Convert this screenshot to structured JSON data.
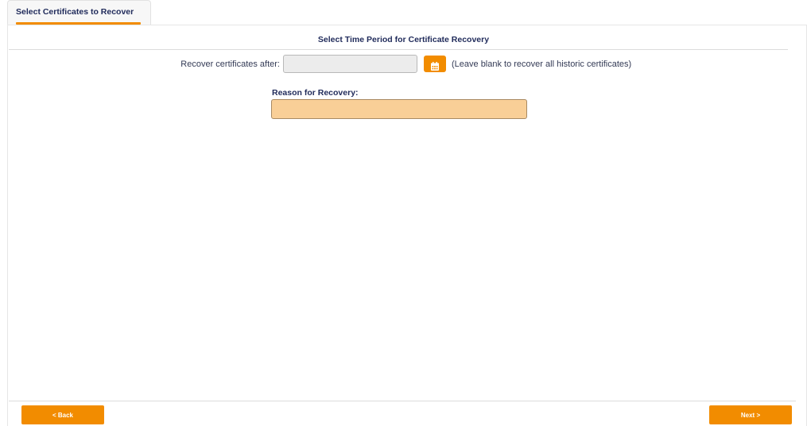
{
  "tabs": [
    {
      "label": "Select Certificates to Recover",
      "active": true
    }
  ],
  "section": {
    "title": "Select Time Period for Certificate Recovery"
  },
  "recover_after": {
    "label": "Recover certificates after:",
    "value": "",
    "placeholder": "",
    "calendar_icon": "calendar-icon",
    "hint": "(Leave blank to recover all historic certificates)"
  },
  "reason": {
    "label": "Reason for Recovery:",
    "value": "",
    "placeholder": ""
  },
  "footer": {
    "back_label": "< Back",
    "next_label": "Next >"
  },
  "colors": {
    "accent": "#f28c00",
    "text": "#1f2a5a",
    "reason_field_bg": "#f9cf97",
    "date_field_bg": "#ececec"
  }
}
